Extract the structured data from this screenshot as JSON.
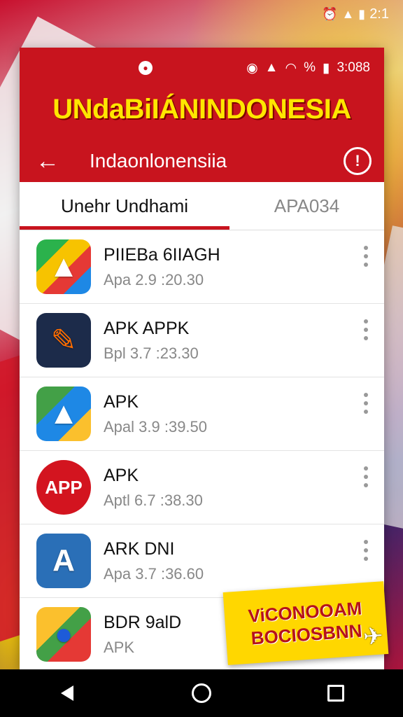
{
  "status_bar": {
    "time": "2:1",
    "icons": [
      "alarm-icon",
      "signal-icon",
      "battery-icon"
    ]
  },
  "app": {
    "inner_status": {
      "time": "3:088",
      "battery_percent": "%"
    },
    "banner_title": "UNdaBiIÁNINDONESIA",
    "toolbar": {
      "title": "Indaonlonensiia"
    },
    "tabs": [
      {
        "label": "Unehr Undhami",
        "active": true
      },
      {
        "label": "APA034",
        "active": false
      }
    ],
    "items": [
      {
        "name": "PIIEBa 6IIAGH",
        "sub": "Apa 2.9 :20.30",
        "icon": "maps-app-icon"
      },
      {
        "name": "APK APPK",
        "sub": "Bpl 3.7 :23.30",
        "icon": "apk-tool-icon"
      },
      {
        "name": "APK",
        "sub": "Apal 3.9 :39.50",
        "icon": "triangle-app-icon"
      },
      {
        "name": "APK",
        "sub": "Aptl 6.7 :38.30",
        "icon": "app-circle-icon"
      },
      {
        "name": "ARK DNI",
        "sub": "Apa 3.7 :36.60",
        "icon": "letter-a-app-icon"
      },
      {
        "name": "BDR 9alD",
        "sub": "APK",
        "icon": "map-pin-app-icon"
      }
    ],
    "item_icon_glyphs": [
      "▲",
      "✎",
      "▲",
      "APP",
      "A",
      "●"
    ]
  },
  "promo": {
    "line1": "ViCONOOAM",
    "line2": "BOCIOSBNN"
  },
  "colors": {
    "header_red": "#c8141e",
    "banner_yellow": "#ffe600",
    "promo_yellow": "#ffd700"
  }
}
